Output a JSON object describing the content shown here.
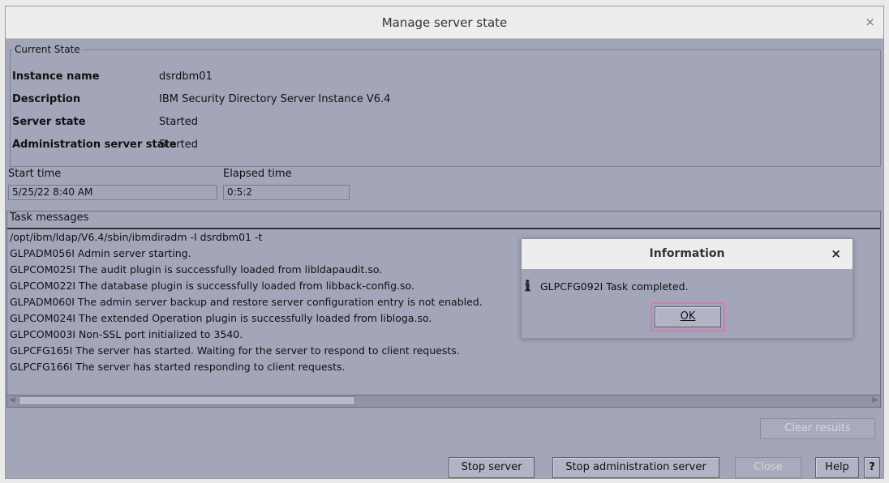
{
  "window": {
    "title": "Manage server state",
    "close_glyph": "×"
  },
  "current_state": {
    "legend": "Current State",
    "rows": [
      {
        "key": "Instance name",
        "value": "dsrdbm01"
      },
      {
        "key": "Description",
        "value": "IBM Security Directory Server Instance V6.4"
      },
      {
        "key": "Server state",
        "value": "Started"
      },
      {
        "key": "Administration server state",
        "value": "Started"
      }
    ]
  },
  "times": {
    "start_label": "Start time",
    "start_value": "5/25/22 8:40 AM",
    "elapsed_label": "Elapsed time",
    "elapsed_value": "0:5:2"
  },
  "task_messages": {
    "header": "Task messages",
    "lines": [
      "/opt/ibm/ldap/V6.4/sbin/ibmdiradm -I dsrdbm01 -t",
      "GLPADM056I Admin server starting.",
      "GLPCOM025I The audit plugin is successfully loaded from libldapaudit.so.",
      "GLPCOM022I The database plugin is successfully loaded from libback-config.so.",
      "GLPADM060I The admin server backup and restore server configuration entry is not enabled.",
      "GLPCOM024I The extended Operation plugin is successfully loaded from libloga.so.",
      "GLPCOM003I Non-SSL port initialized to 3540.",
      "GLPCFG165I The server has started. Waiting for the server to respond to client requests.",
      "GLPCFG166I The server has started responding to client requests."
    ]
  },
  "buttons": {
    "clear_results": "Clear results",
    "stop_server": "Stop server",
    "stop_admin_server": "Stop administration server",
    "close": "Close",
    "help": "Help",
    "question": "?"
  },
  "dialog": {
    "title": "Information",
    "close_glyph": "×",
    "icon": "info-icon",
    "message": "GLPCFG092I Task completed.",
    "ok": "OK"
  }
}
